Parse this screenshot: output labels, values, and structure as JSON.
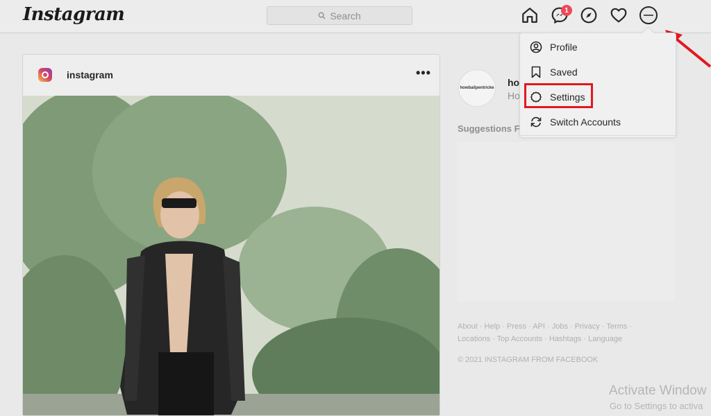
{
  "header": {
    "logo": "Instagram",
    "search_placeholder": "Search",
    "messages_badge": "1"
  },
  "post": {
    "username": "instagram",
    "more": "•••"
  },
  "sidebar": {
    "profile_avatar_text": "howbailpentricke",
    "profile_name": "ho",
    "profile_sub": "Ho",
    "suggestions_title": "Suggestions Fo",
    "footer_links": "About · Help · Press · API · Jobs · Privacy · Terms · Locations · Top Accounts · Hashtags · Language",
    "copyright": "© 2021 INSTAGRAM FROM FACEBOOK"
  },
  "menu": {
    "items": [
      {
        "label": "Profile",
        "icon": "profile-icon"
      },
      {
        "label": "Saved",
        "icon": "bookmark-icon"
      },
      {
        "label": "Settings",
        "icon": "gear-icon"
      },
      {
        "label": "Switch Accounts",
        "icon": "switch-icon"
      }
    ]
  },
  "watermark": {
    "line1": "Activate Window",
    "line2": "Go to Settings to activa"
  },
  "colors": {
    "highlight": "#e0191f",
    "badge": "#ed4956"
  }
}
